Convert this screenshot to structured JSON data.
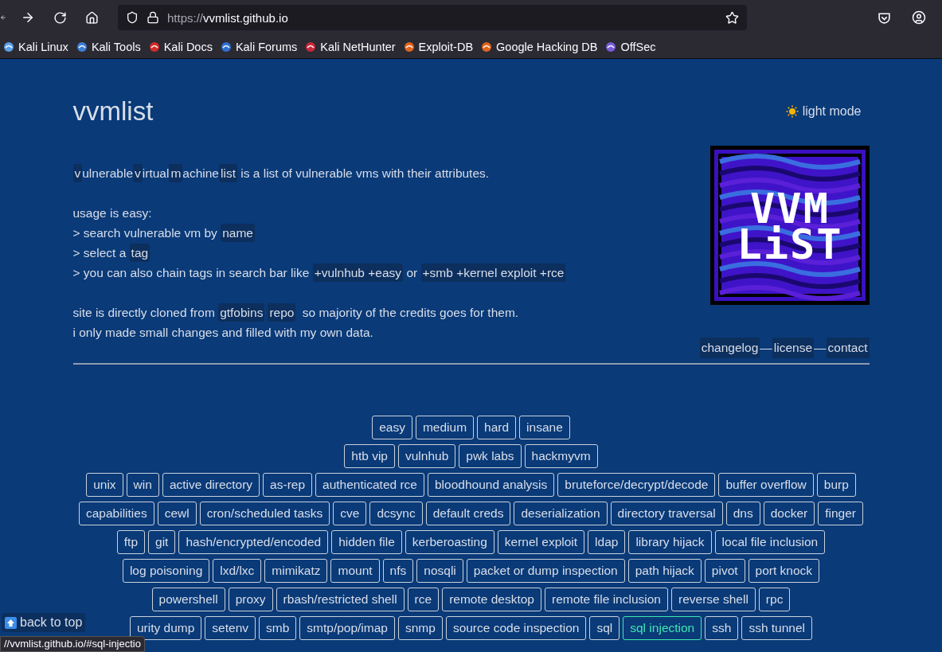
{
  "browser": {
    "url_scheme": "https://",
    "url_host": "vvmlist.github.io",
    "bookmarks": [
      {
        "label": "Kali Linux",
        "color": "#5aa0e6"
      },
      {
        "label": "Kali Tools",
        "color": "#3d7fd6"
      },
      {
        "label": "Kali Docs",
        "color": "#d42a2a"
      },
      {
        "label": "Kali Forums",
        "color": "#2f6fd1"
      },
      {
        "label": "Kali NetHunter",
        "color": "#c9283a"
      },
      {
        "label": "Exploit-DB",
        "color": "#e0641c"
      },
      {
        "label": "Google Hacking DB",
        "color": "#e0641c"
      },
      {
        "label": "OffSec",
        "color": "#7a5cd6"
      }
    ]
  },
  "header": {
    "title": "vvmlist",
    "theme_toggle": "light mode"
  },
  "logo": {
    "lines": [
      "VVM",
      "LiST"
    ]
  },
  "intro": [
    [
      {
        "t": "v",
        "kind": "code"
      },
      {
        "t": "ulnerable",
        "kind": "text"
      },
      {
        "t": "v",
        "kind": "code"
      },
      {
        "t": "irtual",
        "kind": "text"
      },
      {
        "t": "m",
        "kind": "code"
      },
      {
        "t": "achine",
        "kind": "text"
      },
      {
        "t": "list",
        "kind": "code"
      },
      {
        "t": " is a list of vulnerable vms with their attributes.",
        "kind": "text"
      }
    ],
    [
      {
        "kind": "gap"
      }
    ],
    [
      {
        "t": "usage is easy:",
        "kind": "text"
      }
    ],
    [
      {
        "t": "> search vulnerable vm by ",
        "kind": "text"
      },
      {
        "t": "name",
        "kind": "link"
      }
    ],
    [
      {
        "t": "> select a ",
        "kind": "text"
      },
      {
        "t": "tag",
        "kind": "link"
      }
    ],
    [
      {
        "t": "> you can also chain tags in search bar like ",
        "kind": "text"
      },
      {
        "t": "+vulnhub +easy",
        "kind": "code"
      },
      {
        "t": " or ",
        "kind": "text"
      },
      {
        "t": "+smb +kernel exploit +rce",
        "kind": "code"
      }
    ],
    [
      {
        "kind": "gap"
      }
    ],
    [
      {
        "t": "site is directly cloned from ",
        "kind": "text"
      },
      {
        "t": "gtfobins",
        "kind": "link"
      },
      {
        "t": "repo",
        "kind": "link"
      },
      {
        "t": " so majority of the credits goes for them.",
        "kind": "text"
      }
    ],
    [
      {
        "t": "i only made small changes and filled with my own data.",
        "kind": "text"
      }
    ]
  ],
  "nav": [
    {
      "label": "changelog",
      "kind": "link"
    },
    {
      "label": "—",
      "kind": "sep"
    },
    {
      "label": "license",
      "kind": "link"
    },
    {
      "label": "—",
      "kind": "sep"
    },
    {
      "label": "contact",
      "kind": "link"
    }
  ],
  "tag_rows": [
    [
      {
        "label": "easy",
        "selected": false
      },
      {
        "label": "medium",
        "selected": false
      },
      {
        "label": "hard",
        "selected": false
      },
      {
        "label": "insane",
        "selected": false
      }
    ],
    [
      {
        "label": "htb vip",
        "selected": false
      },
      {
        "label": "vulnhub",
        "selected": false
      },
      {
        "label": "pwk labs",
        "selected": false
      },
      {
        "label": "hackmyvm",
        "selected": false
      }
    ],
    [
      {
        "label": "unix",
        "selected": false
      },
      {
        "label": "win",
        "selected": false
      },
      {
        "label": "active directory",
        "selected": false
      },
      {
        "label": "as-rep",
        "selected": false
      },
      {
        "label": "authenticated rce",
        "selected": false
      },
      {
        "label": "bloodhound analysis",
        "selected": false
      },
      {
        "label": "bruteforce/decrypt/decode",
        "selected": false
      },
      {
        "label": "buffer overflow",
        "selected": false
      },
      {
        "label": "burp",
        "selected": false
      }
    ],
    [
      {
        "label": "capabilities",
        "selected": false
      },
      {
        "label": "cewl",
        "selected": false
      },
      {
        "label": "cron/scheduled tasks",
        "selected": false
      },
      {
        "label": "cve",
        "selected": false
      },
      {
        "label": "dcsync",
        "selected": false
      },
      {
        "label": "default creds",
        "selected": false
      },
      {
        "label": "deserialization",
        "selected": false
      },
      {
        "label": "directory traversal",
        "selected": false
      },
      {
        "label": "dns",
        "selected": false
      },
      {
        "label": "docker",
        "selected": false
      },
      {
        "label": "finger",
        "selected": false
      }
    ],
    [
      {
        "label": "ftp",
        "selected": false
      },
      {
        "label": "git",
        "selected": false
      },
      {
        "label": "hash/encrypted/encoded",
        "selected": false
      },
      {
        "label": "hidden file",
        "selected": false
      },
      {
        "label": "kerberoasting",
        "selected": false
      },
      {
        "label": "kernel exploit",
        "selected": false
      },
      {
        "label": "ldap",
        "selected": false
      },
      {
        "label": "library hijack",
        "selected": false
      },
      {
        "label": "local file inclusion",
        "selected": false
      }
    ],
    [
      {
        "label": "log poisoning",
        "selected": false
      },
      {
        "label": "lxd/lxc",
        "selected": false
      },
      {
        "label": "mimikatz",
        "selected": false
      },
      {
        "label": "mount",
        "selected": false
      },
      {
        "label": "nfs",
        "selected": false
      },
      {
        "label": "nosqli",
        "selected": false
      },
      {
        "label": "packet or dump inspection",
        "selected": false
      },
      {
        "label": "path hijack",
        "selected": false
      },
      {
        "label": "pivot",
        "selected": false
      },
      {
        "label": "port knock",
        "selected": false
      }
    ],
    [
      {
        "label": "powershell",
        "selected": false
      },
      {
        "label": "proxy",
        "selected": false
      },
      {
        "label": "rbash/restricted shell",
        "selected": false
      },
      {
        "label": "rce",
        "selected": false
      },
      {
        "label": "remote desktop",
        "selected": false
      },
      {
        "label": "remote file inclusion",
        "selected": false
      },
      {
        "label": "reverse shell",
        "selected": false
      },
      {
        "label": "rpc",
        "selected": false
      }
    ],
    [
      {
        "label": "urity dump",
        "selected": false
      },
      {
        "label": "setenv",
        "selected": false
      },
      {
        "label": "smb",
        "selected": false
      },
      {
        "label": "smtp/pop/imap",
        "selected": false
      },
      {
        "label": "snmp",
        "selected": false
      },
      {
        "label": "source code inspection",
        "selected": false
      },
      {
        "label": "sql",
        "selected": false
      },
      {
        "label": "sql injection",
        "selected": true
      },
      {
        "label": "ssh",
        "selected": false
      },
      {
        "label": "ssh tunnel",
        "selected": false
      }
    ]
  ],
  "back_to_top": "back to top",
  "status_url": "//vvmlist.github.io/#sql-injectio"
}
